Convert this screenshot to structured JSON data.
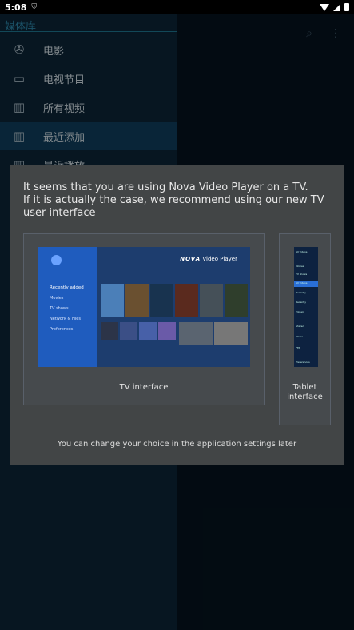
{
  "status_bar": {
    "time": "5:08"
  },
  "drawer": {
    "header": "媒体库",
    "items": [
      {
        "label": "电影",
        "icon": "film-reel-icon",
        "active": false
      },
      {
        "label": "电视节目",
        "icon": "tv-icon",
        "active": false
      },
      {
        "label": "所有视频",
        "icon": "filmstrip-icon",
        "active": false
      },
      {
        "label": "最近添加",
        "icon": "recent-added-icon",
        "active": true
      },
      {
        "label": "最近播放",
        "icon": "recent-played-icon",
        "active": false
      }
    ]
  },
  "dialog": {
    "message_line1": "It seems that you are using Nova Video Player on a TV.",
    "message_line2": "If it is actually the case, we recommend using our new TV user interface",
    "options": [
      {
        "label": "TV interface"
      },
      {
        "label": "Tablet interface"
      }
    ],
    "footer": "You can change your choice in the application settings later"
  },
  "tv_preview": {
    "brand_nova": "NOVA",
    "brand_rest": "Video Player",
    "menu": [
      "Recently added",
      "Movies",
      "TV shows",
      "Network & Files",
      "Preferences"
    ]
  },
  "tablet_preview": {
    "rows": [
      "All videos",
      "Movies",
      "TV shows",
      "All videos",
      "Recently",
      "Recently",
      "Folders",
      "Shared",
      "Media",
      "FTP",
      "Preferences"
    ]
  },
  "colors": {
    "drawer_bg": "#0b2233",
    "drawer_active": "#0f3a56",
    "dialog_bg": "#424546",
    "accent": "#1d6f88"
  }
}
